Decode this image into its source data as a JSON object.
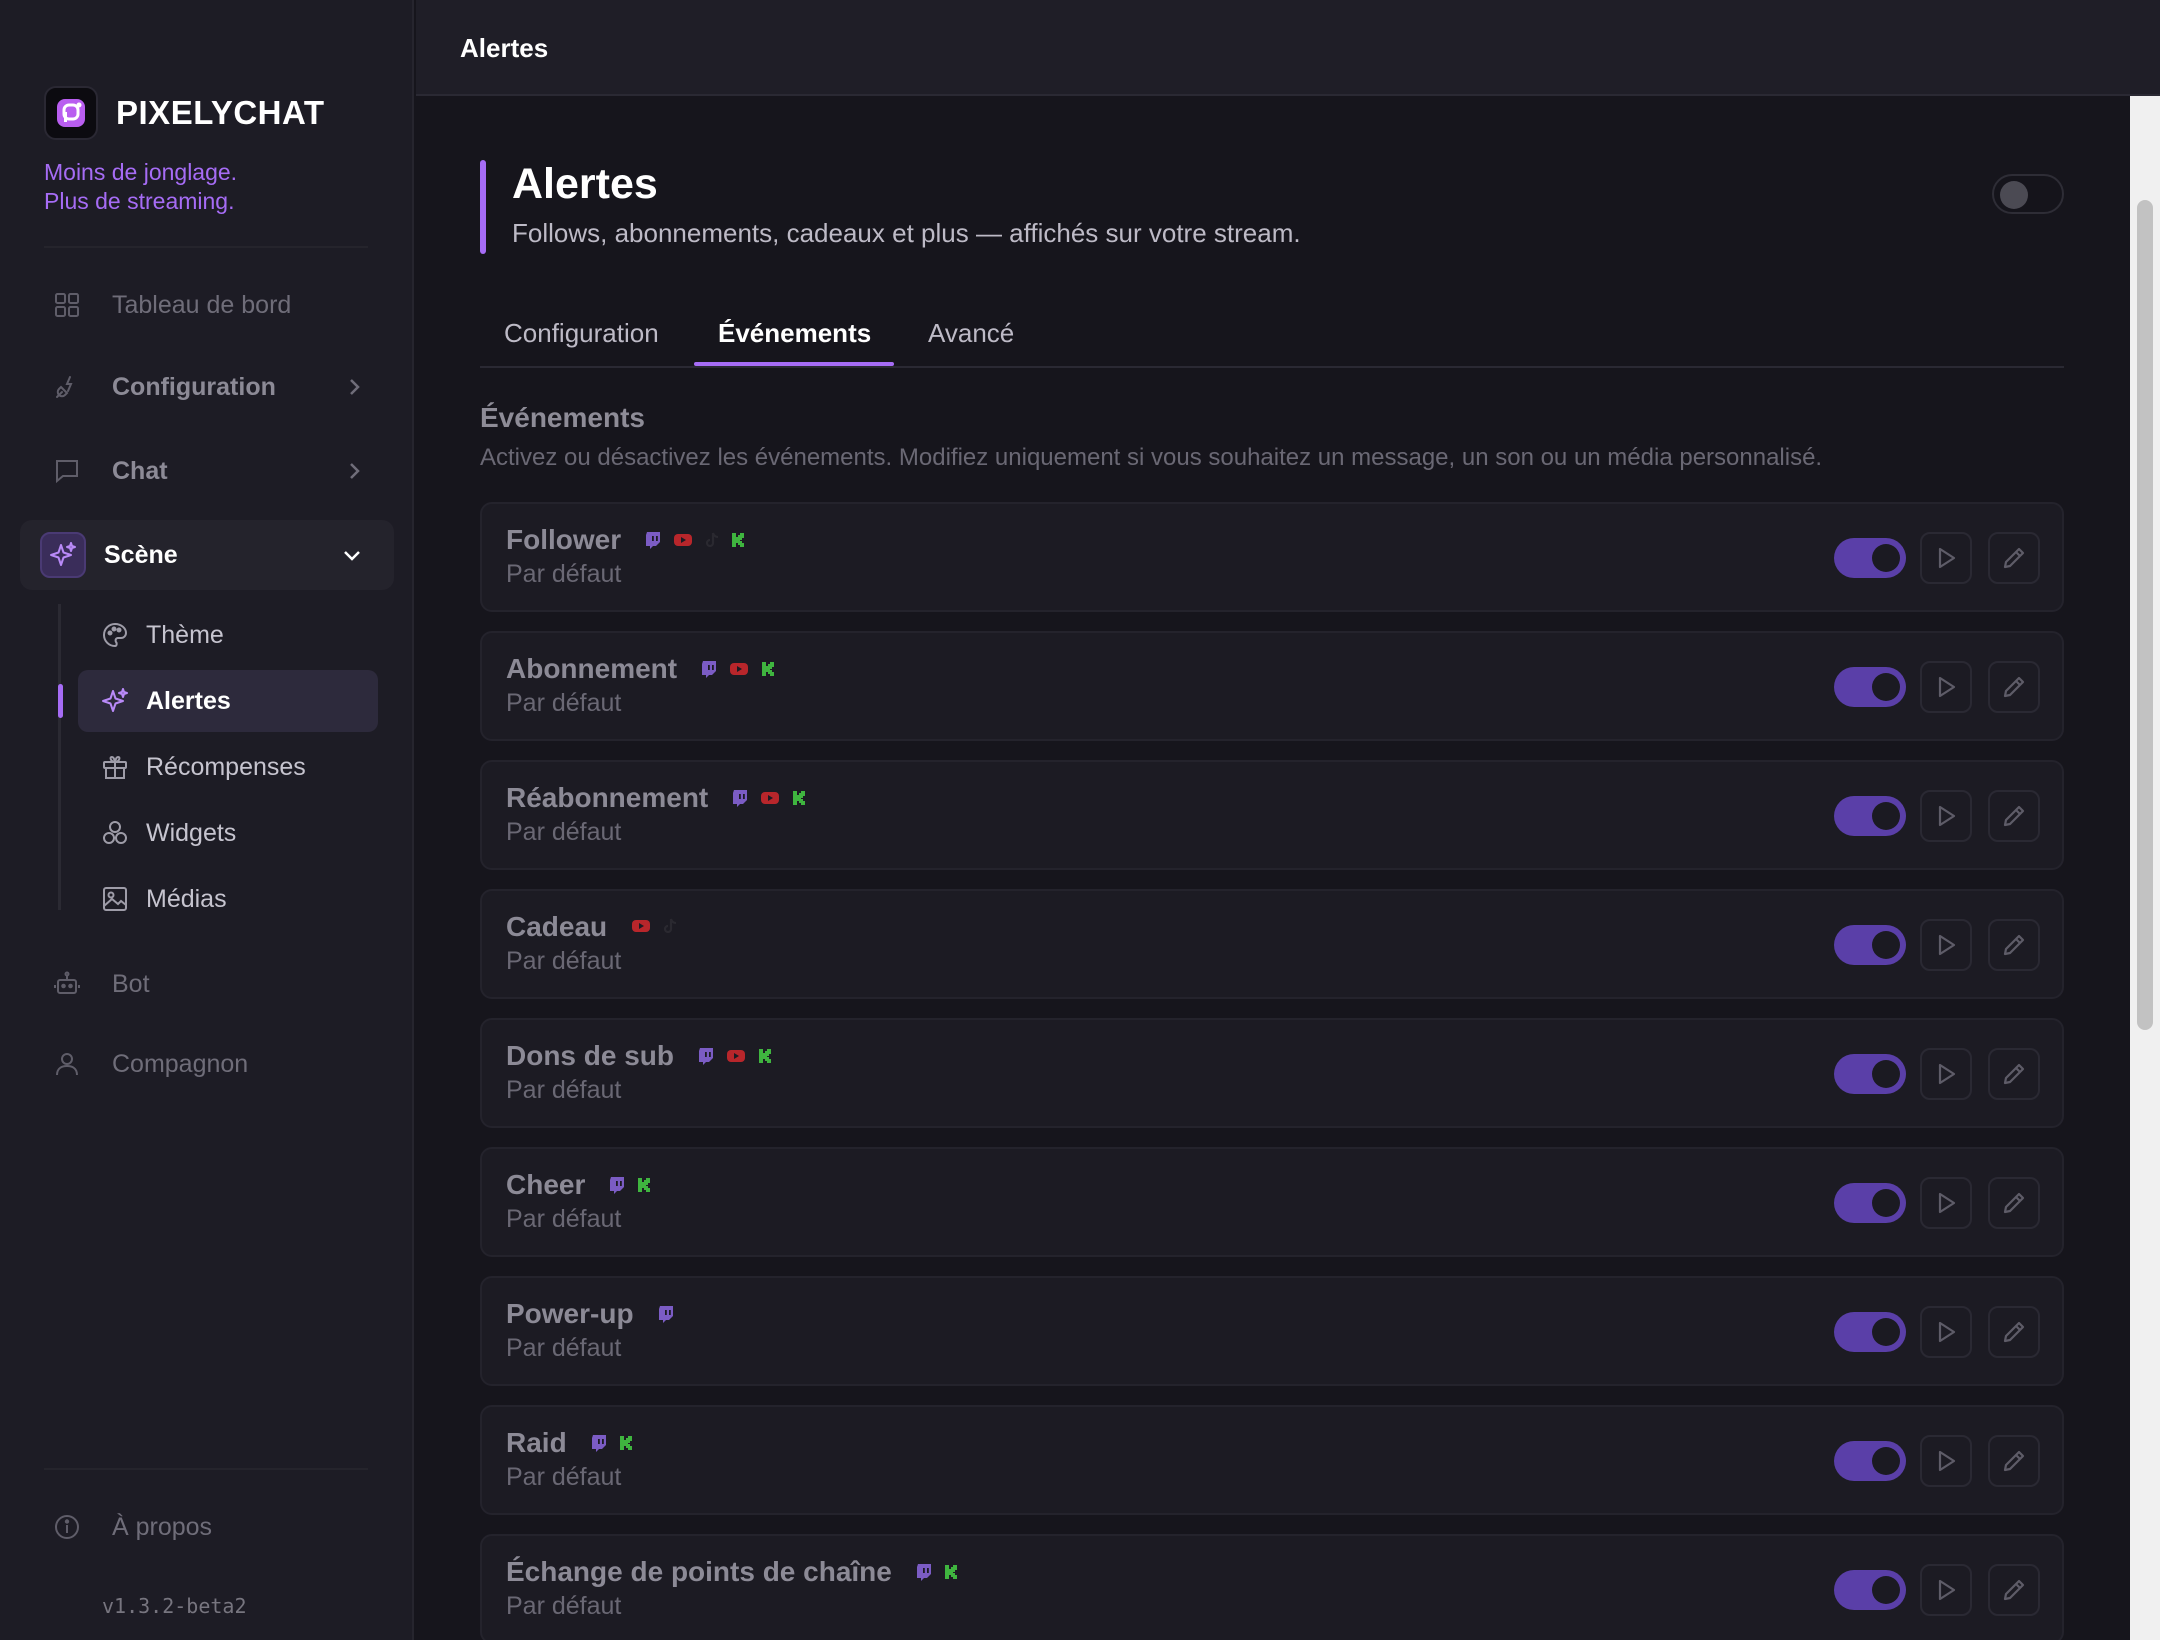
{
  "app": {
    "name": "PIXELYCHAT",
    "tagline_line1": "Moins de jonglage.",
    "tagline_line2": "Plus de streaming.",
    "version": "v1.3.2-beta2",
    "accent_color": "#a66cf5"
  },
  "sidebar": {
    "dashboard": "Tableau de bord",
    "configuration": "Configuration",
    "chat": "Chat",
    "scene": "Scène",
    "scene_items": [
      "Thème",
      "Alertes",
      "Récompenses",
      "Widgets",
      "Médias"
    ],
    "bot": "Bot",
    "companion": "Compagnon",
    "about": "À propos"
  },
  "topbar": {
    "title": "Alertes"
  },
  "page": {
    "title": "Alertes",
    "subtitle": "Follows, abonnements, cadeaux et plus — affichés sur votre stream.",
    "enabled": false
  },
  "tabs": [
    "Configuration",
    "Événements",
    "Avancé"
  ],
  "active_tab": "Événements",
  "events_section": {
    "title": "Événements",
    "description": "Activez ou désactivez les événements. Modifiez uniquement si vous souhaitez un message, un son ou un média personnalisé."
  },
  "events": [
    {
      "name": "Follower",
      "status": "Par défaut",
      "platforms": [
        "twitch",
        "youtube",
        "tiktok",
        "kick"
      ],
      "enabled": true
    },
    {
      "name": "Abonnement",
      "status": "Par défaut",
      "platforms": [
        "twitch",
        "youtube",
        "kick"
      ],
      "enabled": true
    },
    {
      "name": "Réabonnement",
      "status": "Par défaut",
      "platforms": [
        "twitch",
        "youtube",
        "kick"
      ],
      "enabled": true
    },
    {
      "name": "Cadeau",
      "status": "Par défaut",
      "platforms": [
        "youtube",
        "tiktok"
      ],
      "enabled": true
    },
    {
      "name": "Dons de sub",
      "status": "Par défaut",
      "platforms": [
        "twitch",
        "youtube",
        "kick"
      ],
      "enabled": true
    },
    {
      "name": "Cheer",
      "status": "Par défaut",
      "platforms": [
        "twitch",
        "kick"
      ],
      "enabled": true
    },
    {
      "name": "Power-up",
      "status": "Par défaut",
      "platforms": [
        "twitch"
      ],
      "enabled": true
    },
    {
      "name": "Raid",
      "status": "Par défaut",
      "platforms": [
        "twitch",
        "kick"
      ],
      "enabled": true
    },
    {
      "name": "Échange de points de chaîne",
      "status": "Par défaut",
      "platforms": [
        "twitch",
        "kick"
      ],
      "enabled": true
    }
  ],
  "platform_colors": {
    "twitch": "#7b5cc4",
    "youtube": "#b8262b",
    "tiktok": "#2a2930",
    "kick": "#3fb53f"
  }
}
